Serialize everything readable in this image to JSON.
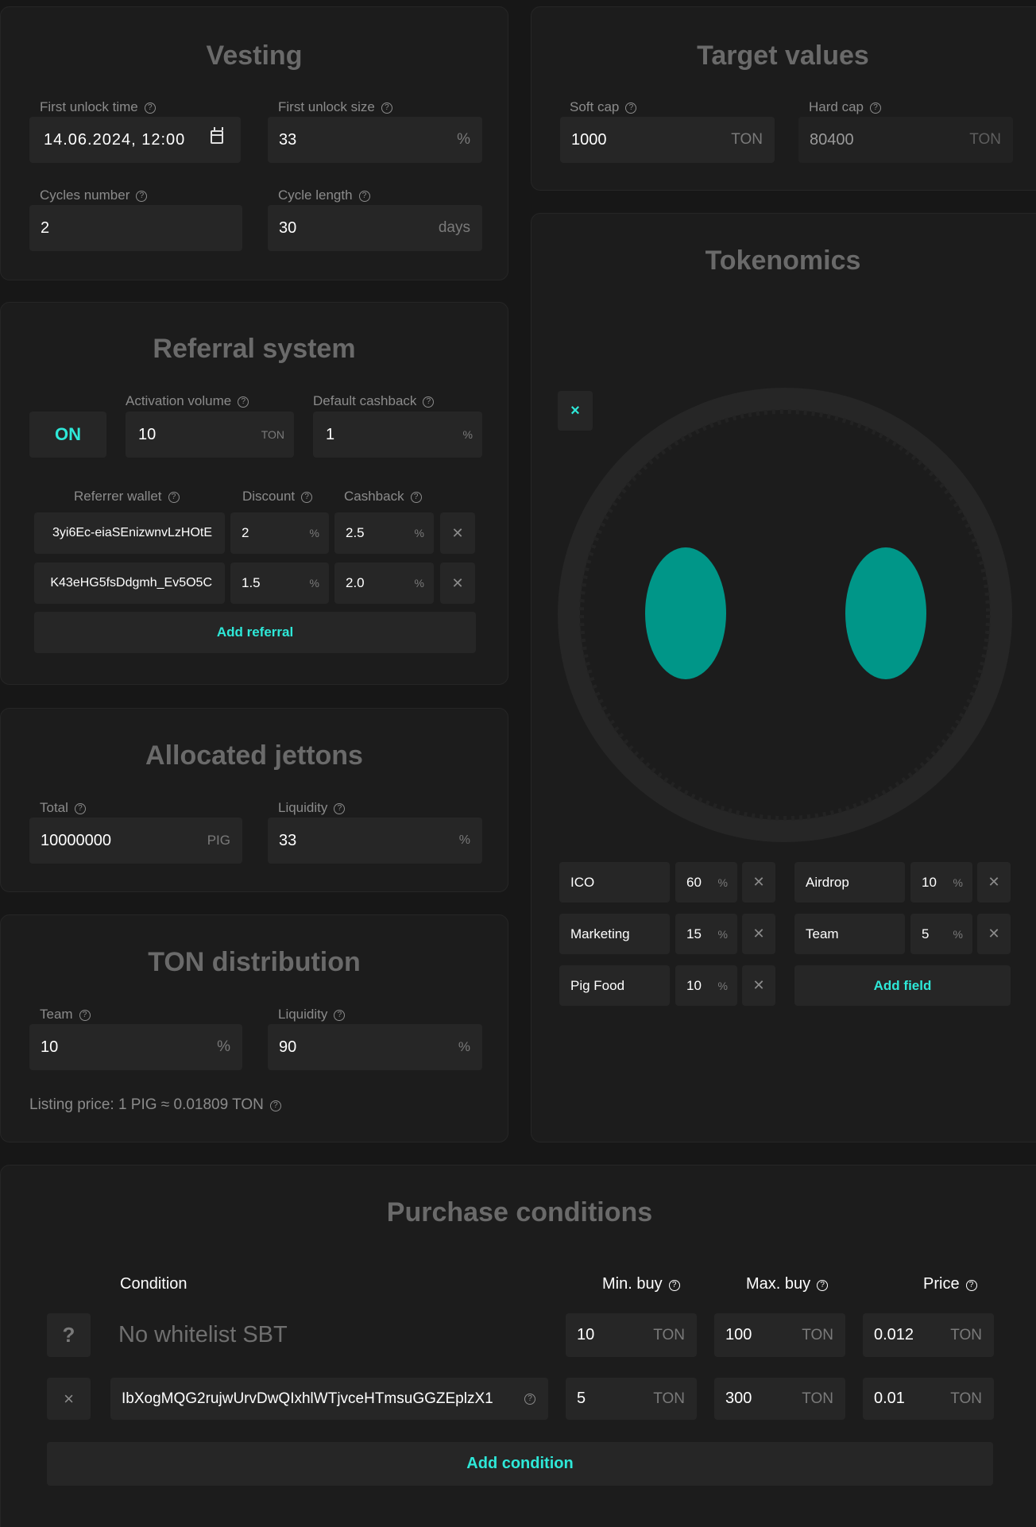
{
  "vesting": {
    "title": "Vesting",
    "first_unlock_time_label": "First unlock time",
    "first_unlock_time_value": "14.06.2024, 12:00",
    "first_unlock_size_label": "First unlock size",
    "first_unlock_size_value": "33",
    "first_unlock_size_unit": "%",
    "cycles_number_label": "Cycles number",
    "cycles_number_value": "2",
    "cycle_length_label": "Cycle length",
    "cycle_length_value": "30",
    "cycle_length_unit": "days"
  },
  "target": {
    "title": "Target values",
    "soft_cap_label": "Soft cap",
    "soft_cap_value": "1000",
    "soft_cap_unit": "TON",
    "hard_cap_label": "Hard cap",
    "hard_cap_value": "80400",
    "hard_cap_unit": "TON"
  },
  "referral": {
    "title": "Referral system",
    "toggle_label": "ON",
    "activation_label": "Activation volume",
    "activation_value": "10",
    "activation_unit": "TON",
    "default_cashback_label": "Default cashback",
    "default_cashback_value": "1",
    "default_cashback_unit": "%",
    "col_wallet": "Referrer wallet",
    "col_discount": "Discount",
    "col_cashback": "Cashback",
    "rows": [
      {
        "wallet": "3yi6Ec-eiaSEnizwnvLzHOtE",
        "discount": "2",
        "cashback": "2.5",
        "unit": "%"
      },
      {
        "wallet": "K43eHG5fsDdgmh_Ev5O5C",
        "discount": "1.5",
        "cashback": "2.0",
        "unit": "%"
      }
    ],
    "add_label": "Add referral"
  },
  "allocated": {
    "title": "Allocated jettons",
    "total_label": "Total",
    "total_value": "10000000",
    "total_unit": "PIG",
    "liquidity_label": "Liquidity",
    "liquidity_value": "33",
    "liquidity_unit": "%"
  },
  "ton_dist": {
    "title": "TON distribution",
    "team_label": "Team",
    "team_value": "10",
    "team_unit": "%",
    "liquidity_label": "Liquidity",
    "liquidity_value": "90",
    "liquidity_unit": "%",
    "listing_price": "Listing price: 1 PIG ≈ 0.01809 TON"
  },
  "tokenomics": {
    "title": "Tokenomics",
    "close_icon_glyph": "×",
    "accent_color": "#009688",
    "fields": [
      {
        "name": "ICO",
        "value": "60",
        "unit": "%"
      },
      {
        "name": "Airdrop",
        "value": "10",
        "unit": "%"
      },
      {
        "name": "Marketing",
        "value": "15",
        "unit": "%"
      },
      {
        "name": "Team",
        "value": "5",
        "unit": "%"
      },
      {
        "name": "Pig Food",
        "value": "10",
        "unit": "%"
      }
    ],
    "add_label": "Add field"
  },
  "purchase": {
    "title": "Purchase conditions",
    "col_condition": "Condition",
    "col_min": "Min. buy",
    "col_max": "Max. buy",
    "col_price": "Price",
    "row1": {
      "icon": "?",
      "condition": "No whitelist SBT",
      "min": "10",
      "max": "100",
      "price": "0.012",
      "unit": "TON"
    },
    "row2": {
      "icon": "×",
      "condition": "IbXogMQG2rujwUrvDwQIxhlWTjvceHTmsuGGZEplzX1",
      "min": "5",
      "max": "300",
      "price": "0.01",
      "unit": "TON"
    },
    "add_label": "Add condition"
  }
}
